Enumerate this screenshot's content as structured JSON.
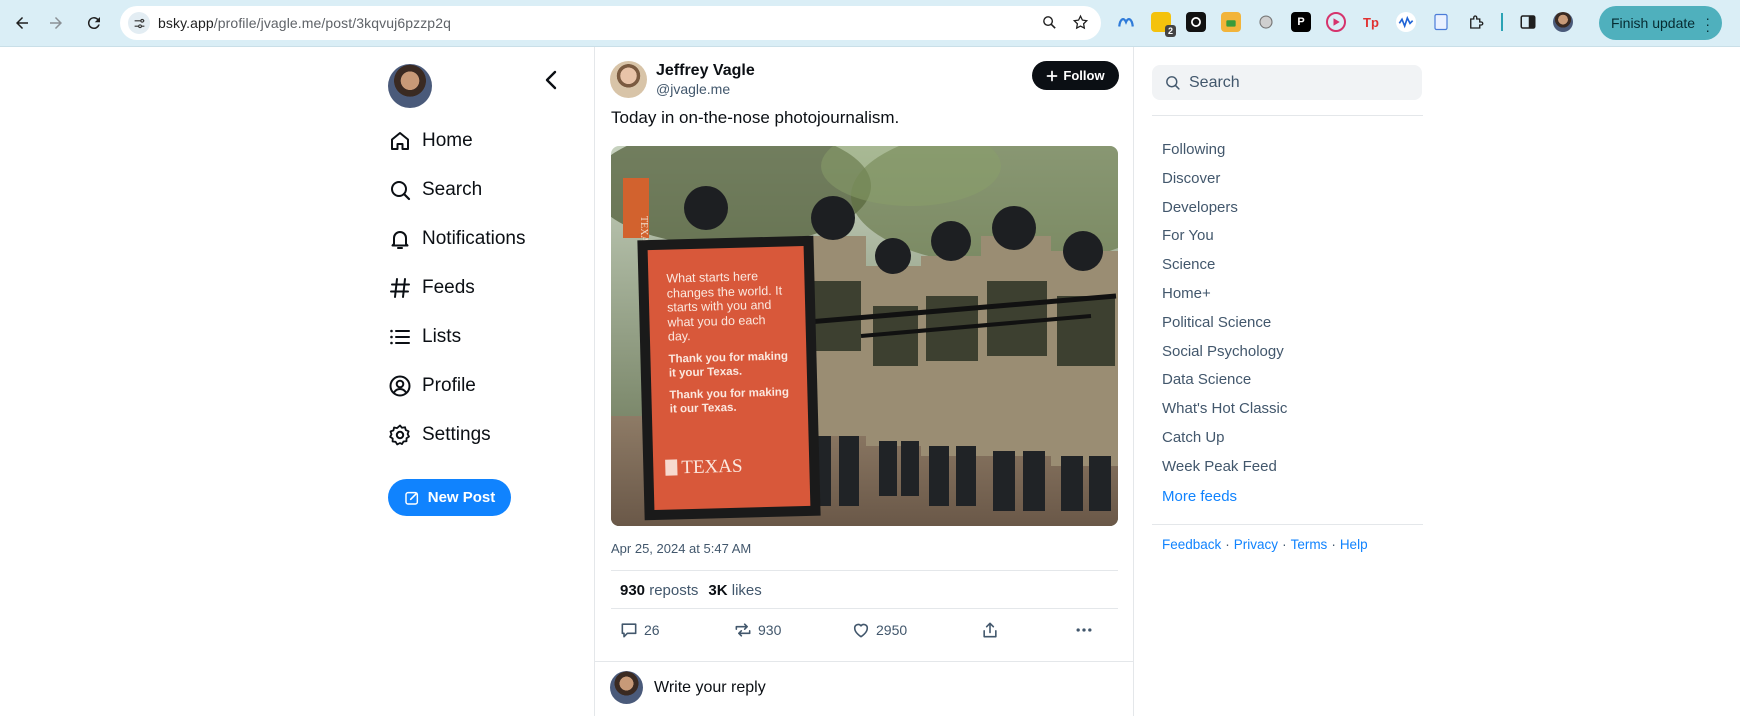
{
  "browser": {
    "url_host": "bsky.app",
    "url_path": "/profile/jvagle.me/post/3kqvuj6pzzp2q",
    "finish_update_label": "Finish update",
    "extension_badge": "2"
  },
  "left_nav": {
    "items": [
      {
        "label": "Home",
        "icon": "home-icon"
      },
      {
        "label": "Search",
        "icon": "search-icon"
      },
      {
        "label": "Notifications",
        "icon": "bell-icon"
      },
      {
        "label": "Feeds",
        "icon": "hash-icon"
      },
      {
        "label": "Lists",
        "icon": "list-icon"
      },
      {
        "label": "Profile",
        "icon": "user-circle-icon"
      },
      {
        "label": "Settings",
        "icon": "gear-icon"
      }
    ],
    "new_post_label": "New Post"
  },
  "post": {
    "author_name": "Jeffrey Vagle",
    "author_handle": "@jvagle.me",
    "follow_label": "Follow",
    "text": "Today in on-the-nose photojournalism.",
    "image": {
      "sign_text_1": "What starts here changes the world. It starts with you and what you do each day.",
      "sign_text_2": "Thank you for making it your Texas.",
      "sign_text_3": "Thank you for making it our Texas.",
      "sign_logo": "TEXAS",
      "banner_text": "TEXAS"
    },
    "date": "Apr 25, 2024 at 5:47 AM",
    "reposts_count": "930",
    "reposts_label": "reposts",
    "likes_count": "3K",
    "likes_label": "likes",
    "reply_count": "26",
    "repost_count": "930",
    "like_count": "2950",
    "reply_placeholder": "Write your reply"
  },
  "right_panel": {
    "search_placeholder": "Search",
    "feeds": [
      "Following",
      "Discover",
      "Developers",
      "For You",
      "Science",
      "Home+",
      "Political Science",
      "Social Psychology",
      "Data Science",
      "What's Hot Classic",
      "Catch Up",
      "Week Peak Feed"
    ],
    "more_feeds_label": "More feeds",
    "footer": [
      "Feedback",
      "Privacy",
      "Terms",
      "Help"
    ]
  },
  "colors": {
    "accent": "#1083fe",
    "chrome_bg": "#daeef6",
    "finish_btn": "#4fb0bd"
  }
}
